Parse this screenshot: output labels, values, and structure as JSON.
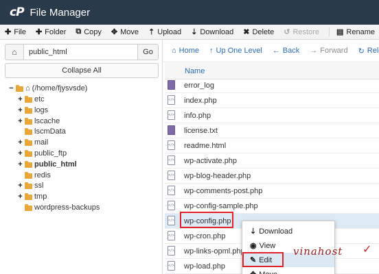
{
  "app": {
    "logo": "cP",
    "title": "File Manager"
  },
  "toolbar": [
    {
      "icon": "plus-icon",
      "glyph": "✚",
      "label": "File"
    },
    {
      "icon": "plus-icon",
      "glyph": "✚",
      "label": "Folder"
    },
    {
      "icon": "copy-icon",
      "glyph": "⧉",
      "label": "Copy"
    },
    {
      "icon": "move-icon",
      "glyph": "✥",
      "label": "Move"
    },
    {
      "icon": "upload-icon",
      "glyph": "⇡",
      "label": "Upload"
    },
    {
      "icon": "download-icon",
      "glyph": "⇣",
      "label": "Download"
    },
    {
      "icon": "delete-icon",
      "glyph": "✖",
      "label": "Delete"
    },
    {
      "icon": "restore-icon",
      "glyph": "↺",
      "label": "Restore",
      "disabled": true
    },
    {
      "icon": "rename-icon",
      "glyph": "▤",
      "label": "Rename"
    }
  ],
  "path": {
    "home_icon": "home-icon",
    "value": "public_html",
    "go_label": "Go"
  },
  "collapse_label": "Collapse All",
  "tree": [
    {
      "label": "(/home/fjysvsde)",
      "toggle": "−",
      "icon": "folder-home-icon",
      "depth": 0
    },
    {
      "label": "etc",
      "toggle": "+",
      "depth": 1
    },
    {
      "label": "logs",
      "toggle": "+",
      "depth": 1
    },
    {
      "label": "lscache",
      "toggle": "+",
      "depth": 1
    },
    {
      "label": "lscmData",
      "toggle": "",
      "depth": 1
    },
    {
      "label": "mail",
      "toggle": "+",
      "depth": 1
    },
    {
      "label": "public_ftp",
      "toggle": "+",
      "depth": 1
    },
    {
      "label": "public_html",
      "toggle": "+",
      "depth": 1,
      "bold": true
    },
    {
      "label": "redis",
      "toggle": "",
      "depth": 1
    },
    {
      "label": "ssl",
      "toggle": "+",
      "depth": 1
    },
    {
      "label": "tmp",
      "toggle": "+",
      "depth": 1
    },
    {
      "label": "wordpress-backups",
      "toggle": "",
      "depth": 1
    }
  ],
  "nav": [
    {
      "icon": "home-icon",
      "glyph": "⌂",
      "label": "Home"
    },
    {
      "icon": "up-level-icon",
      "glyph": "↑",
      "label": "Up One Level"
    },
    {
      "icon": "back-icon",
      "glyph": "←",
      "label": "Back"
    },
    {
      "icon": "forward-icon",
      "glyph": "→",
      "label": "Forward",
      "disabled": true
    },
    {
      "icon": "reload-icon",
      "glyph": "↻",
      "label": "Reload"
    }
  ],
  "table": {
    "name_header": "Name"
  },
  "files": [
    {
      "name": "error_log",
      "type": "doc"
    },
    {
      "name": "index.php",
      "type": "code"
    },
    {
      "name": "info.php",
      "type": "code"
    },
    {
      "name": "license.txt",
      "type": "doc"
    },
    {
      "name": "readme.html",
      "type": "code"
    },
    {
      "name": "wp-activate.php",
      "type": "code"
    },
    {
      "name": "wp-blog-header.php",
      "type": "code"
    },
    {
      "name": "wp-comments-post.php",
      "type": "code"
    },
    {
      "name": "wp-config-sample.php",
      "type": "code"
    },
    {
      "name": "wp-config.php",
      "type": "code",
      "selected": true
    },
    {
      "name": "wp-cron.php",
      "type": "code"
    },
    {
      "name": "wp-links-opml.php",
      "type": "code"
    },
    {
      "name": "wp-load.php",
      "type": "code"
    }
  ],
  "context_menu": [
    {
      "icon": "download-icon",
      "glyph": "⇣",
      "label": "Download"
    },
    {
      "icon": "eye-icon",
      "glyph": "◉",
      "label": "View"
    },
    {
      "icon": "pencil-icon",
      "glyph": "✎",
      "label": "Edit",
      "hover": true
    },
    {
      "icon": "move-icon",
      "glyph": "✥",
      "label": "Move"
    }
  ],
  "watermark": "vinahost"
}
